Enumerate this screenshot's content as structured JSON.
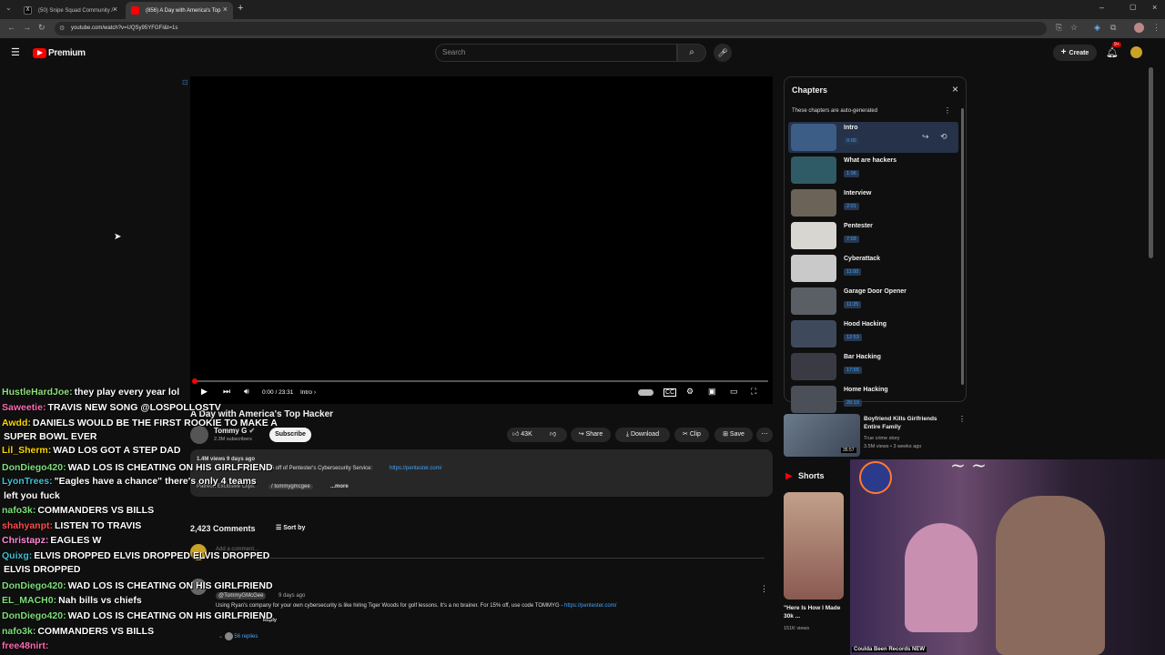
{
  "browser": {
    "tabs": [
      {
        "title": "(50) Snipe Squad Community /"
      },
      {
        "title": "(856) A Day with America's Top"
      }
    ],
    "url": "youtube.com/watch?v=UQSy95YFGFI&t=1s"
  },
  "yt": {
    "logo": "Premium",
    "search_placeholder": "Search",
    "create_label": "Create",
    "notif_count": "9+"
  },
  "player": {
    "time": "0:00 / 23:31",
    "chapter": "Intro"
  },
  "video": {
    "title": "A Day with America's Top Hacker",
    "channel": "Tommy G",
    "subs": "2.3M subscribers",
    "subscribe": "Subscribe",
    "likes": "43K",
    "share": "Share",
    "download": "Download",
    "clip": "Clip",
    "save": "Save",
    "views": "1.4M views  9 days ago",
    "desc_line": "15% off of Pentester's Cybersecurity Service:",
    "desc_link": "https://pentester.com/",
    "patreon": "Patreon Exclusive Clips:",
    "handle": "/ tommygmcgee",
    "more": "...more"
  },
  "comments": {
    "count": "2,423 Comments",
    "sort": "Sort by",
    "add": "Add a comment...",
    "pinned_author": "@TommyGMcGee",
    "pinned_age": "9 days ago",
    "pinned_text": "Using Ryan's company for your own cybersecurity is like hiring Tiger Woods for golf lessons.  It's a no brainer.  For 15% off, use code TOMMYG -",
    "pinned_link": "https://pentester.com/",
    "reply": "Reply",
    "replies": "56 replies"
  },
  "chapters": {
    "heading": "Chapters",
    "note": "These chapters are auto-generated",
    "items": [
      {
        "title": "Intro",
        "time": "0:00"
      },
      {
        "title": "What are hackers",
        "time": "1:06"
      },
      {
        "title": "Interview",
        "time": "2:01"
      },
      {
        "title": "Pentester",
        "time": "7:03"
      },
      {
        "title": "Cyberattack",
        "time": "11:00"
      },
      {
        "title": "Garage Door Opener",
        "time": "11:25"
      },
      {
        "title": "Hood Hacking",
        "time": "12:53"
      },
      {
        "title": "Bar Hacking",
        "time": "17:55"
      },
      {
        "title": "Home Hacking",
        "time": "20:19"
      }
    ]
  },
  "recommended": {
    "title": "Boyfriend Kills Girlfriends Entire Family",
    "channel": "True crime story",
    "meta": "3.5M views • 3 weeks ago",
    "duration": "35:57"
  },
  "shorts": {
    "heading": "Shorts",
    "item_title": "\"Here Is How I Made 30k ...",
    "item_views": "151K views",
    "next_label": "Coulda Been Records NEW"
  },
  "chat": [
    {
      "user": "HustleHardJoe:",
      "msg": "they play every year lol",
      "color": "#8ee07a"
    },
    {
      "user": "Saweetie:",
      "msg": "TRAVIS NEW SONG @LOSPOLLOSTV",
      "color": "#ff69b4"
    },
    {
      "user": "Awdd:",
      "msg": "DANIELS WOULD BE THE FIRST ROOKIE TO MAKE A",
      "color": "#ffd700"
    },
    {
      "user": "",
      "msg": "SUPER BOWL EVER",
      "color": "#ffffff"
    },
    {
      "user": "Lil_Sherm:",
      "msg": "WAD LOS GOT A STEP DAD",
      "color": "#ffd700"
    },
    {
      "user": "DonDiego420:",
      "msg": "WAD LOS IS CHEATING ON HIS GIRLFRIEND",
      "color": "#7ee07a"
    },
    {
      "user": "LyonTrees:",
      "msg": "\"Eagles have a chance\" there's only 4 teams",
      "color": "#3ec1d3"
    },
    {
      "user": "",
      "msg": "left you fuck",
      "color": "#ffffff"
    },
    {
      "user": "nafo3k:",
      "msg": "COMMANDERS VS BILLS",
      "color": "#7ee07a"
    },
    {
      "user": "shahyanpt:",
      "msg": "LISTEN TO TRAVIS",
      "color": "#ff4d4d"
    },
    {
      "user": "Christapz:",
      "msg": "EAGLES W",
      "color": "#ff8ad8"
    },
    {
      "user": "Quixg:",
      "msg": "ELVIS DROPPED ELVIS DROPPED ELVIS DROPPED",
      "color": "#3ec1d3"
    },
    {
      "user": "",
      "msg": "ELVIS DROPPED",
      "color": "#ffffff"
    },
    {
      "user": "DonDiego420:",
      "msg": "WAD LOS IS CHEATING ON HIS GIRLFRIEND",
      "color": "#7ee07a"
    },
    {
      "user": "EL_MACH0:",
      "msg": "Nah bills vs chiefs",
      "color": "#7ee07a"
    },
    {
      "user": "DonDiego420:",
      "msg": "WAD LOS IS CHEATING ON HIS GIRLFRIEND",
      "color": "#7ee07a"
    },
    {
      "user": "nafo3k:",
      "msg": "COMMANDERS VS BILLS",
      "color": "#7ee07a"
    },
    {
      "user": "free48nirt:",
      "msg": "",
      "color": "#ff69b4"
    }
  ]
}
